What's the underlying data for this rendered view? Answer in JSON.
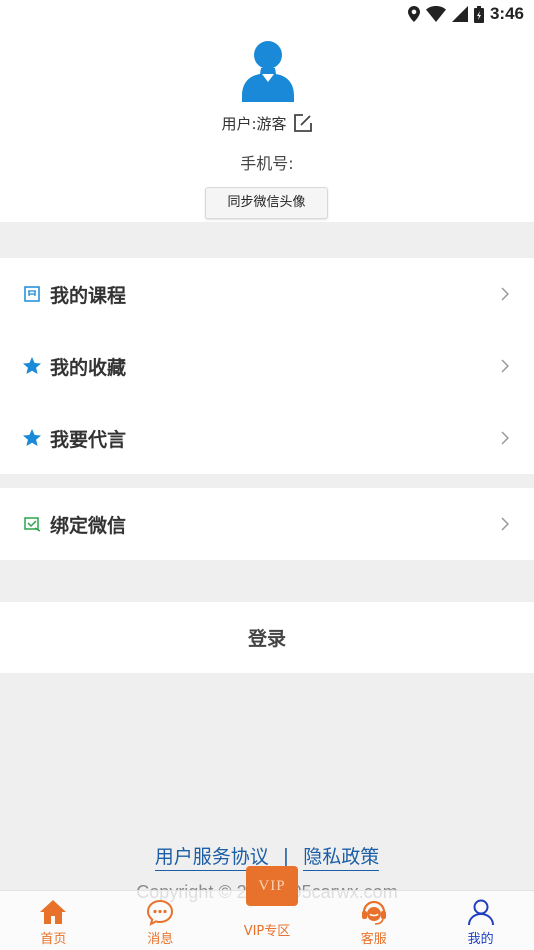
{
  "status_bar": {
    "time": "3:46"
  },
  "profile": {
    "username": "用户:游客",
    "phone_label": "手机号:",
    "sync_button": "同步微信头像"
  },
  "menu_group1": [
    {
      "label": "我的课程",
      "icon": "course-icon"
    },
    {
      "label": "我的收藏",
      "icon": "star-icon"
    },
    {
      "label": "我要代言",
      "icon": "star-icon"
    }
  ],
  "menu_group2": [
    {
      "label": "绑定微信",
      "icon": "wechat-bind-icon"
    }
  ],
  "login_label": "登录",
  "footer": {
    "user_agreement": "用户服务协议",
    "separator": "|",
    "privacy_policy": "隐私政策",
    "copyright": "Copyright © 2020 195carwx.com"
  },
  "tabbar": {
    "vip_badge": "VIP",
    "tabs": [
      {
        "label": "首页",
        "icon": "home-icon"
      },
      {
        "label": "消息",
        "icon": "message-icon"
      },
      {
        "label": "VIP专区",
        "icon": "vip-icon"
      },
      {
        "label": "客服",
        "icon": "customer-service-icon"
      },
      {
        "label": "我的",
        "icon": "user-icon",
        "active": true
      }
    ]
  },
  "colors": {
    "accent": "#e8722b",
    "active_tab": "#1e3fbf",
    "star": "#1a8ad8",
    "link": "#1c5ea6"
  }
}
